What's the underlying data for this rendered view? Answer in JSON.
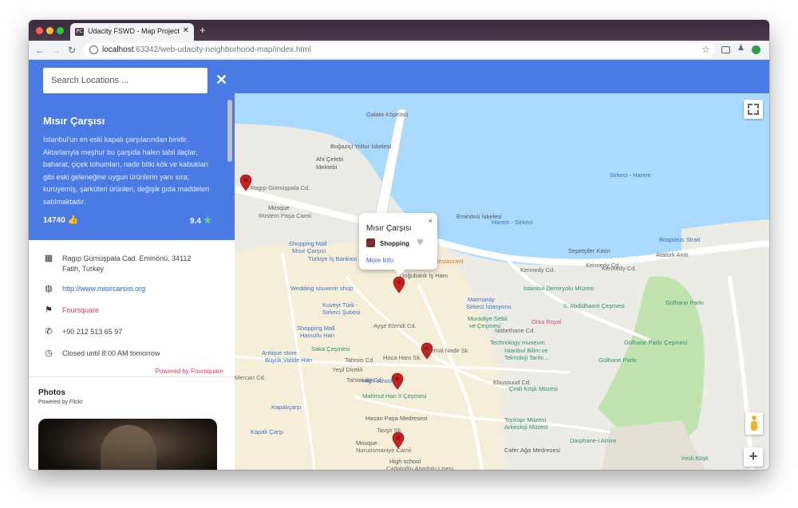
{
  "browser": {
    "tab_title": "Udacity FSWD - Map Project",
    "tab_favicon": "PC",
    "url_host": "localhost",
    "url_rest": ":63342/web-udacity-neighborhood-map/index.html"
  },
  "sidebar": {
    "search_placeholder": "Search Locations ...",
    "place": {
      "title": "Mısır Çarşısı",
      "description": "İstanbul'un en eski kapalı çarşılarından biridir. Aktarlarıyla meşhur bu çarşıda halen tabii ilaçlar, baharat, çiçek tohumları, nadir bitki kök ve kabukları gibi eski geleneğine uygun ürünlerin yanı sıra; kuruyemiş, şarküteri ürünleri, değişik gıda maddeleri satılmaktadır.",
      "likes": "14740",
      "rating": "9.4"
    },
    "details": {
      "address": "Ragıp Gümüşpala Cad. Eminönü, 34112 Fatih, Turkey",
      "website": "http://www.misircarsisi.org",
      "foursquare": "Foursquare",
      "phone": "+90 212 513 65 97",
      "hours": "Closed until 8:00 AM tomorrow"
    },
    "powered_by_foursquare": "Powered by Foursquare",
    "photos_title": "Photos",
    "powered_by_flickr": "Powered by Flickr"
  },
  "map": {
    "infowindow": {
      "title": "Mısır Çarşısı",
      "category": "Shopping",
      "more_info": "More Info",
      "close": "×"
    },
    "labels": [
      {
        "text": "Galata Köprüsü",
        "color": "#555"
      },
      {
        "text": "Boğaziçi Yoltur İskelesi",
        "color": "#555"
      },
      {
        "text": "Ahi Çelebi",
        "color": "#555"
      },
      {
        "text": "Mektebi",
        "color": "#555"
      },
      {
        "text": "Ragıp Gümüşpala Cd.",
        "color": "#666"
      },
      {
        "text": "Mosque",
        "color": "#555"
      },
      {
        "text": "Rüstem Paşa Camii",
        "color": "#666"
      },
      {
        "text": "Eminönü İskelesi",
        "color": "#555"
      },
      {
        "text": "Bosporus Strait",
        "color": "#3c6fb0"
      },
      {
        "text": "Sepetçiler Kasrı",
        "color": "#555"
      },
      {
        "text": "Atatürk Anıtı",
        "color": "#555"
      },
      {
        "text": "Kennedy Cd.",
        "color": "#666"
      },
      {
        "text": "Kennedy Cd.",
        "color": "#666"
      },
      {
        "text": "Shopping Mall",
        "color": "#3f6fd1"
      },
      {
        "text": "Mısır Çarşısı",
        "color": "#3f6fd1"
      },
      {
        "text": "Türkiye İş Bankası",
        "color": "#3f6fd1"
      },
      {
        "text": "Restaurant",
        "color": "#d97b36"
      },
      {
        "text": "Doğubank İş Hanı",
        "color": "#555"
      },
      {
        "text": "Wedding souvenir shop",
        "color": "#3f6fd1"
      },
      {
        "text": "İstanbul Demiryolu Müzesi",
        "color": "#2f8f72"
      },
      {
        "text": "Marmaray",
        "color": "#3f6fd1"
      },
      {
        "text": "Sirkeci İstasyonu",
        "color": "#3f6fd1"
      },
      {
        "text": "Kuveyt Türk -",
        "color": "#3f6fd1"
      },
      {
        "text": "Sirkeci Şubesi",
        "color": "#3f6fd1"
      },
      {
        "text": "II. Abdülhamit Çeşmesi",
        "color": "#2f8f72"
      },
      {
        "text": "Muradiye Sebil",
        "color": "#2f8f72"
      },
      {
        "text": "ve Çeşmesi",
        "color": "#2f8f72"
      },
      {
        "text": "Orka Royal",
        "color": "#d14b8a"
      },
      {
        "text": "Gülhane Parkı Çeşmesi",
        "color": "#2f8f72"
      },
      {
        "text": "Shopping Mall",
        "color": "#3f6fd1"
      },
      {
        "text": "Havuzlu Han",
        "color": "#3f6fd1"
      },
      {
        "text": "Saka Çeşmesi",
        "color": "#2f8f72"
      },
      {
        "text": "Technology museum",
        "color": "#2f8f72"
      },
      {
        "text": "İstanbul Bilim ve",
        "color": "#2f8f72"
      },
      {
        "text": "Teknoloji Tarihi...",
        "color": "#2f8f72"
      },
      {
        "text": "Gülhane Parkı",
        "color": "#2f8f72"
      },
      {
        "text": "Antique store",
        "color": "#3f6fd1"
      },
      {
        "text": "Büyük Valide Han",
        "color": "#3f6fd1"
      },
      {
        "text": "Mercan Cd.",
        "color": "#666"
      },
      {
        "text": "High school",
        "color": "#3f6fd1"
      },
      {
        "text": "Mahmut Han II Çeşmesi",
        "color": "#2f8f72"
      },
      {
        "text": "Çinili Köşk Müzesi",
        "color": "#2f8f72"
      },
      {
        "text": "Kapalıçarşı",
        "color": "#3f6fd1"
      },
      {
        "text": "Kapalı Çarşı",
        "color": "#3f6fd1"
      },
      {
        "text": "Hasan Paşa Medresesi",
        "color": "#555"
      },
      {
        "text": "Topkapı Müzesi",
        "color": "#2f8f72"
      },
      {
        "text": "Arkeoloji Müzesi",
        "color": "#2f8f72"
      },
      {
        "text": "Mosque",
        "color": "#555"
      },
      {
        "text": "Nuruosmaniye Camii",
        "color": "#666"
      },
      {
        "text": "Darphane-i Amire",
        "color": "#2f8f72"
      },
      {
        "text": "Cafer Ağa Medresesi",
        "color": "#555"
      },
      {
        "text": "High school",
        "color": "#555"
      },
      {
        "text": "Cağaloğlu Anadolu Lisesi",
        "color": "#666"
      },
      {
        "text": "İncili Köşk",
        "color": "#2f8f72"
      },
      {
        "text": "Ebussuud Cd.",
        "color": "#666"
      },
      {
        "text": "Nöbethane Cd.",
        "color": "#666"
      },
      {
        "text": "Ayşe Efendi Cd.",
        "color": "#666"
      },
      {
        "text": "Cemal Nadir Sk.",
        "color": "#666"
      },
      {
        "text": "Hoca Hanı Sk.",
        "color": "#666"
      },
      {
        "text": "Tahmis Cd.",
        "color": "#666"
      },
      {
        "text": "Kennedy Cd.",
        "color": "#666"
      },
      {
        "text": "Sirkeci - Harem",
        "color": "#3c6fb0"
      },
      {
        "text": "Harem - Sirkeci",
        "color": "#3c6fb0"
      },
      {
        "text": "Gülhane Parkı",
        "color": "#2f8f72"
      },
      {
        "text": "Tavşir Sk.",
        "color": "#666"
      },
      {
        "text": "Yeşil Direkli",
        "color": "#666"
      },
      {
        "text": "Tahtakale Cd.",
        "color": "#666"
      }
    ]
  },
  "colors": {
    "accent": "#4a7be5",
    "rating_star": "#5fd38d",
    "foursquare": "#e8385a",
    "marker": "#c5221f",
    "water": "#aadaff",
    "park": "#c0e3b0"
  }
}
